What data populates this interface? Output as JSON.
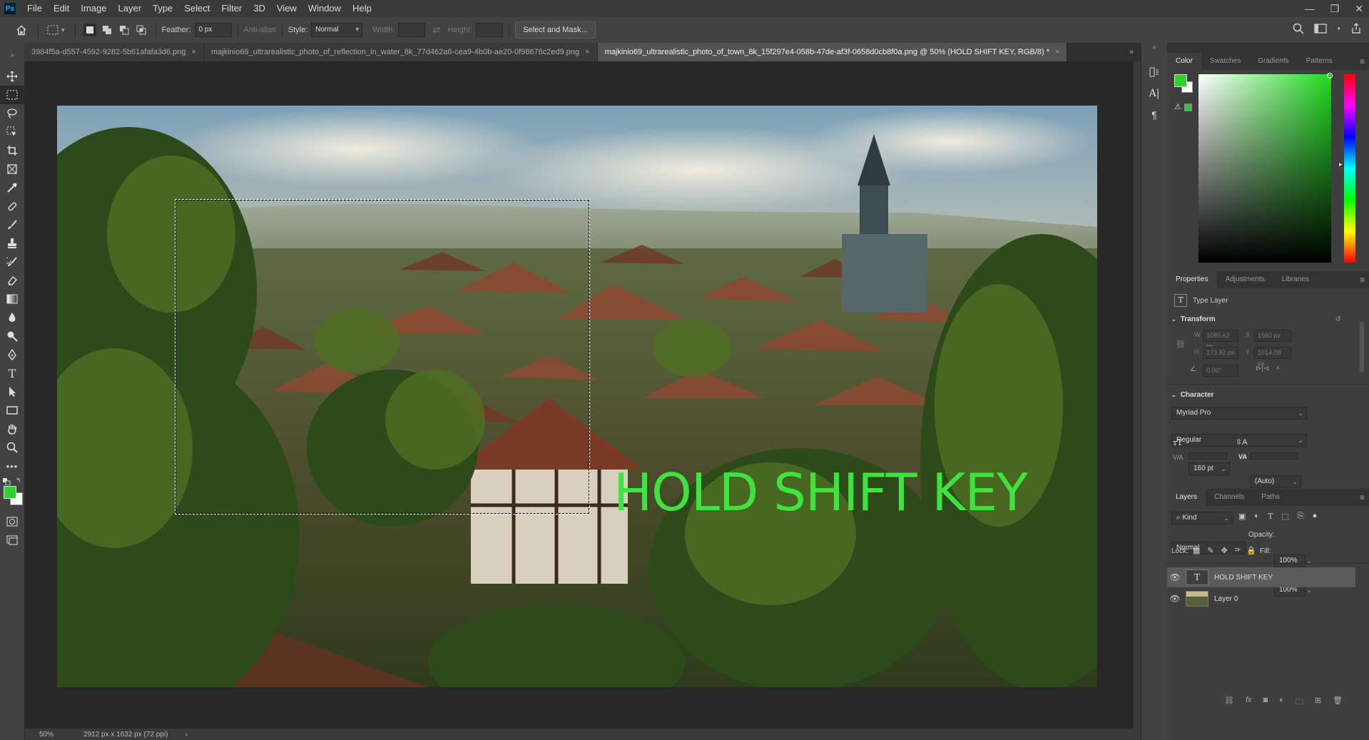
{
  "app": {
    "logo": "Ps",
    "menu": [
      "File",
      "Edit",
      "Image",
      "Layer",
      "Type",
      "Select",
      "Filter",
      "3D",
      "View",
      "Window",
      "Help"
    ],
    "window_controls": [
      "—",
      "❐",
      "✕"
    ]
  },
  "options": {
    "feather_label": "Feather:",
    "feather_value": "0 px",
    "antialias_label": "Anti-alias",
    "style_label": "Style:",
    "style_value": "Normal",
    "width_label": "Width:",
    "height_label": "Height:",
    "select_mask_label": "Select and Mask..."
  },
  "tabs": [
    {
      "label": "3984f5a-d557-4592-9282-5b61afafa3d6.png",
      "active": false
    },
    {
      "label": "majkinio69_ultrarealistic_photo_of_reflection_in_water_8k_77d462a6-cea9-4b0b-ae20-0f98678c2ed9.png",
      "active": false
    },
    {
      "label": "majkinio69_ultrarealistic_photo_of_town_8k_15f297e4-058b-47de-af3f-0658d0cb8f0a.png @ 50% (HOLD SHIFT KEY, RGB/8) *",
      "active": true
    }
  ],
  "canvas": {
    "overlay_text": "HOLD SHIFT KEY",
    "overlay_color": "#3fe33f"
  },
  "status": {
    "zoom": "50%",
    "doc_info": "2912 px x 1632 px (72 ppi)",
    "arrow": "›"
  },
  "colors": {
    "foreground": "#2fd12f",
    "background": "#ffffff"
  },
  "color_panel": {
    "tabs": [
      "Color",
      "Swatches",
      "Gradients",
      "Patterns"
    ]
  },
  "properties_panel": {
    "tabs": [
      "Properties",
      "Adjustments",
      "Libraries"
    ],
    "layer_kind": "Type Layer",
    "transform_title": "Transform",
    "w_label": "W",
    "w_value": "1085.62 px",
    "x_label": "X",
    "x_value": "1560 px",
    "h_label": "H",
    "h_value": "173.92 px",
    "y_label": "Y",
    "y_value": "1014.08 px",
    "angle_value": "0.00°",
    "character_title": "Character",
    "font_family": "Myriad Pro",
    "font_style": "Regular",
    "font_size": "160 pt",
    "leading": "(Auto)",
    "kerning_label": "V/A",
    "tracking_label": "VA"
  },
  "layers_panel": {
    "tabs": [
      "Layers",
      "Channels",
      "Paths"
    ],
    "filter_kind": "Kind",
    "blend_mode": "Normal",
    "opacity_label": "Opacity:",
    "opacity_value": "100%",
    "lock_label": "Lock:",
    "fill_label": "Fill:",
    "fill_value": "100%",
    "layers": [
      {
        "name": "HOLD SHIFT KEY",
        "selected": true
      },
      {
        "name": "Layer 0",
        "selected": false
      }
    ]
  }
}
